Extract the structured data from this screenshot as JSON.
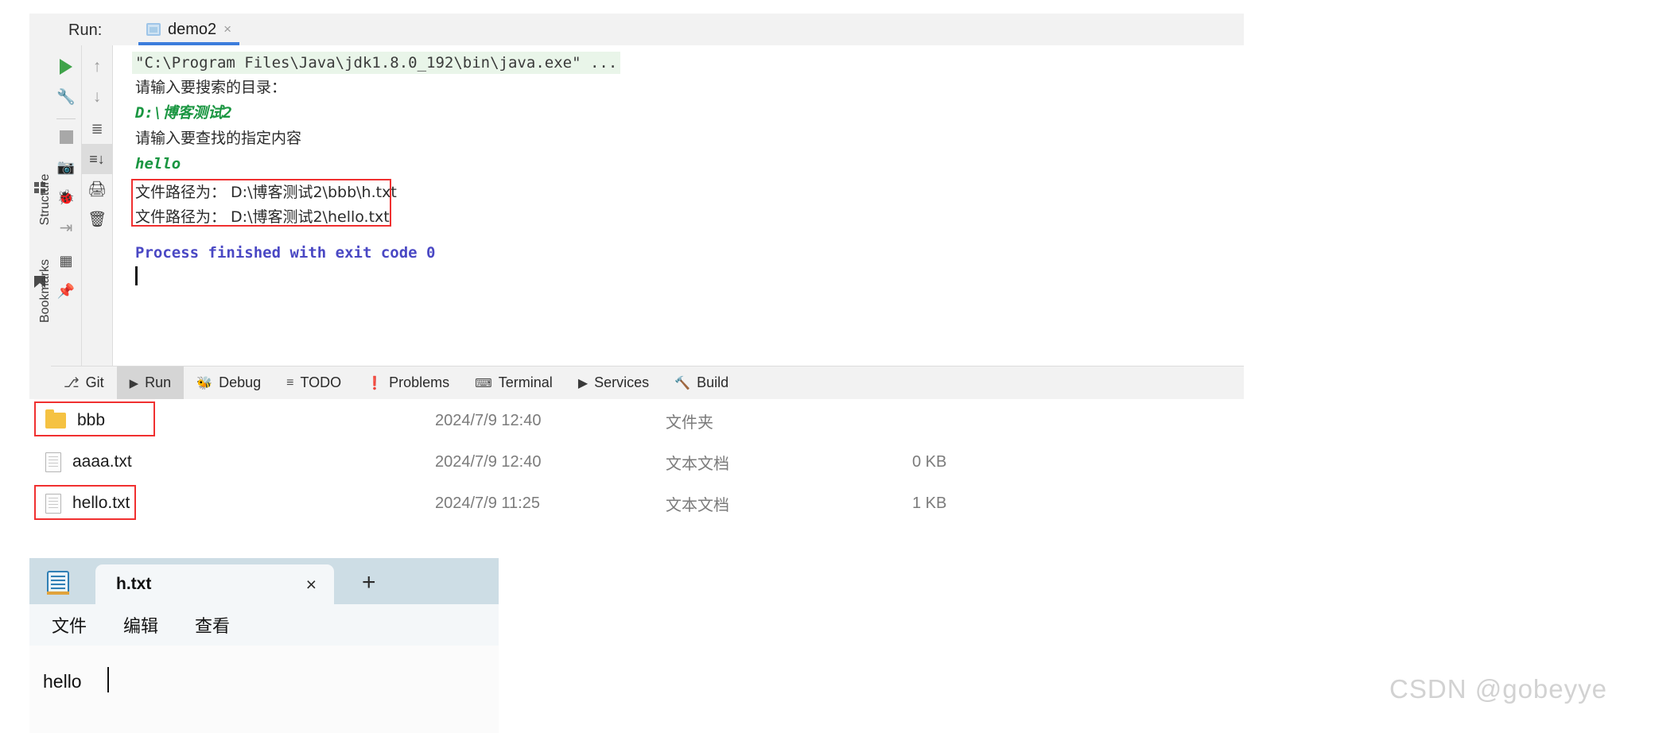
{
  "ide": {
    "run_label": "Run:",
    "tab": {
      "name": "demo2",
      "icon": "run-config-icon",
      "close": "×"
    },
    "vertical_tools": [
      {
        "label": "Structure",
        "icon": "structure-icon"
      },
      {
        "label": "Bookmarks",
        "icon": "bookmark-icon"
      }
    ],
    "left_toolbar": [
      {
        "name": "rerun-icon",
        "glyph": "▶",
        "color": "#3fa349"
      },
      {
        "name": "wrench-icon",
        "glyph": "🔧",
        "color": "#4a4a4a"
      },
      {
        "name": "stop-icon",
        "glyph": "■",
        "color": "#a8a8a8"
      },
      {
        "name": "camera-icon",
        "glyph": "📷",
        "color": "#a0a0a0"
      },
      {
        "name": "debug-rerun-icon",
        "glyph": "🐞",
        "color": "#a0a0a0"
      },
      {
        "name": "import-icon",
        "glyph": "⇥",
        "color": "#a0a0a0"
      }
    ],
    "right_toolbar": [
      {
        "name": "up-arrow-icon",
        "glyph": "↑",
        "color": "#9a9a9a"
      },
      {
        "name": "down-arrow-icon",
        "glyph": "↓",
        "color": "#9a9a9a"
      },
      {
        "name": "soft-wrap-icon",
        "glyph": "≡",
        "color": "#6a6a6a"
      },
      {
        "name": "scroll-to-end-icon",
        "glyph": "≣",
        "color": "#4a4a4a",
        "selected": true
      },
      {
        "name": "print-icon",
        "glyph": "⎙",
        "color": "#4a4a4a"
      },
      {
        "name": "trash-icon",
        "glyph": "🗑",
        "color": "#4a4a4a"
      }
    ],
    "console_lines": [
      {
        "text": "\"C:\\Program Files\\Java\\jdk1.8.0_192\\bin\\java.exe\" ...",
        "style": "cmd"
      },
      {
        "text": "请输入要搜索的目录：",
        "style": "cn"
      },
      {
        "text": "D:\\博客测试2",
        "style": "inp"
      },
      {
        "text": "请输入要查找的指定内容",
        "style": "cn"
      },
      {
        "text": "hello",
        "style": "inp"
      },
      {
        "text": "文件路径为： D:\\博客测试2\\bbb\\h.txt",
        "style": "out"
      },
      {
        "text": "文件路径为： D:\\博客测试2\\hello.txt",
        "style": "out"
      },
      {
        "text": "Process finished with exit code 0",
        "style": "fin"
      }
    ],
    "bottom_tabs": [
      {
        "label": "Git",
        "icon": "git-branch-icon",
        "active": false
      },
      {
        "label": "Run",
        "icon": "run-triangle-icon",
        "active": true
      },
      {
        "label": "Debug",
        "icon": "bug-icon",
        "active": false
      },
      {
        "label": "TODO",
        "icon": "list-icon",
        "active": false
      },
      {
        "label": "Problems",
        "icon": "warning-icon",
        "active": false
      },
      {
        "label": "Terminal",
        "icon": "terminal-icon",
        "active": false
      },
      {
        "label": "Services",
        "icon": "play-circle-icon",
        "active": false
      },
      {
        "label": "Build",
        "icon": "hammer-icon",
        "active": false
      }
    ]
  },
  "explorer": {
    "rows": [
      {
        "name": "bbb",
        "icon": "folder-icon",
        "date": "2024/7/9 12:40",
        "type": "文件夹",
        "size": "",
        "highlighted": true
      },
      {
        "name": "aaaa.txt",
        "icon": "document-icon",
        "date": "2024/7/9 12:40",
        "type": "文本文档",
        "size": "0 KB",
        "highlighted": false
      },
      {
        "name": "hello.txt",
        "icon": "document-icon",
        "date": "2024/7/9 11:25",
        "type": "文本文档",
        "size": "1 KB",
        "highlighted": true
      }
    ]
  },
  "notepad": {
    "app_icon": "notepad-icon",
    "tab_name": "h.txt",
    "tab_close": "×",
    "new_tab": "+",
    "menus": [
      "文件",
      "编辑",
      "查看"
    ],
    "content": "hello"
  },
  "watermark": "CSDN @gobeyye",
  "colors": {
    "accent_blue": "#3c7ddc",
    "highlight_red": "#f03030",
    "input_green": "#1a9641",
    "finished_purple": "#4a48c4"
  }
}
